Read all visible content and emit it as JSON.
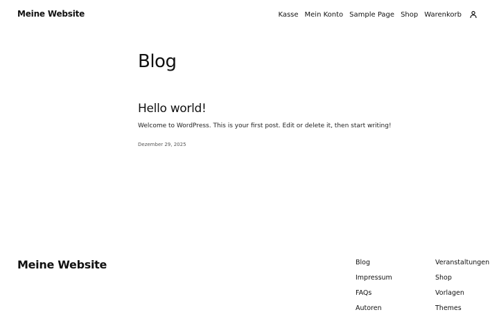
{
  "header": {
    "site_title": "Meine Website",
    "nav": [
      {
        "label": "Kasse"
      },
      {
        "label": "Mein Konto"
      },
      {
        "label": "Sample Page"
      },
      {
        "label": "Shop"
      },
      {
        "label": "Warenkorb"
      }
    ],
    "account_icon": "user-account-icon"
  },
  "main": {
    "page_title": "Blog",
    "posts": [
      {
        "title": "Hello world!",
        "excerpt": "Welcome to WordPress. This is your first post. Edit or delete it, then start writing!",
        "date": "Dezember 29, 2025"
      }
    ]
  },
  "footer": {
    "site_title": "Meine Website",
    "col1": [
      {
        "label": "Blog"
      },
      {
        "label": "Impressum"
      },
      {
        "label": "FAQs"
      },
      {
        "label": "Autoren"
      }
    ],
    "col2": [
      {
        "label": "Veranstaltungen"
      },
      {
        "label": "Shop"
      },
      {
        "label": "Vorlagen"
      },
      {
        "label": "Themes"
      }
    ]
  },
  "colors": {
    "text": "#111111",
    "background": "#ffffff",
    "muted": "#555555"
  }
}
